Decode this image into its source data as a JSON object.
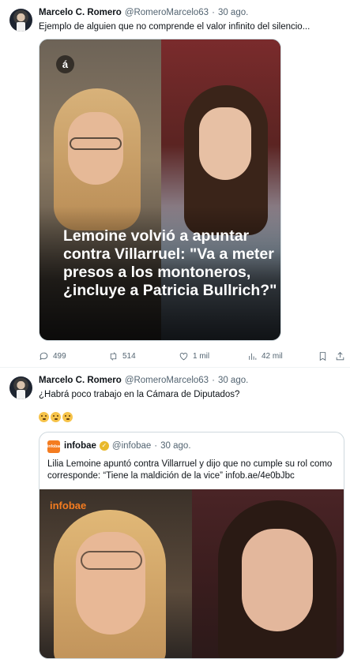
{
  "tweets": [
    {
      "author": {
        "name": "Marcelo C. Romero",
        "handle": "@RomeroMarcelo63",
        "time": "30 ago."
      },
      "text": "Ejemplo de alguien que no comprende el valor infinito del silencio...",
      "media": {
        "brand_mark": "á",
        "headline": "Lemoine volvió a apuntar contra Villarruel: \"Va a meter presos a los montoneros, ¿incluye a Patricia Bullrich?\""
      },
      "actions": {
        "replies": "499",
        "reposts": "514",
        "likes": "1 mil",
        "views": "42 mil"
      }
    },
    {
      "author": {
        "name": "Marcelo C. Romero",
        "handle": "@RomeroMarcelo63",
        "time": "30 ago."
      },
      "text": "¿Habrá poco trabajo en la Cámara de Diputados?",
      "emojis": [
        "thinking-face",
        "thinking-face",
        "thinking-face"
      ],
      "quote": {
        "logo_text": "infobae",
        "name": "infobae",
        "handle": "@infobae",
        "time": "30 ago.",
        "text": "Lilia Lemoine apuntó contra Villarruel y dijo que no cumple su rol como corresponde: “Tiene la maldición de la vice” infob.ae/4e0bJbc",
        "media_brand": "infobae"
      }
    }
  ],
  "separator": "·",
  "colors": {
    "muted": "#536471",
    "border": "#cfd9de",
    "infobae_orange": "#f47c20",
    "verified_gold": "#e8b92d"
  }
}
